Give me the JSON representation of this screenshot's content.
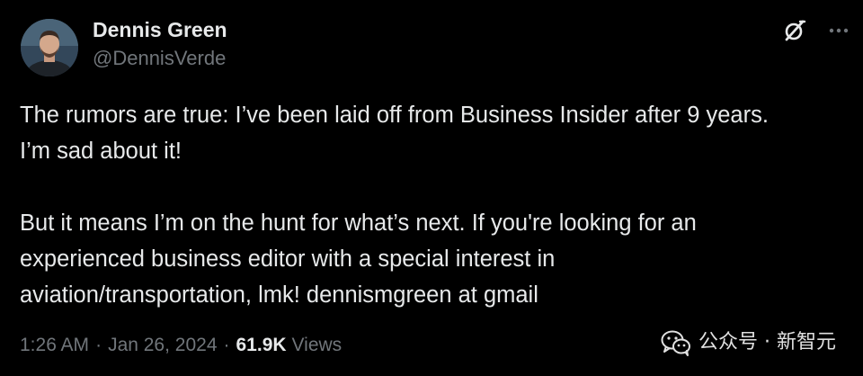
{
  "author": {
    "display_name": "Dennis Green",
    "handle": "@DennisVerde"
  },
  "tweet": {
    "text": "The rumors are true: I’ve been laid off from Business Insider after 9 years.\nI’m sad about it!\n\nBut it means I’m on the hunt for what’s next. If you're looking for an\nexperienced business editor with a special interest in\naviation/transportation, lmk! dennismgreen at gmail"
  },
  "meta": {
    "time": "1:26 AM",
    "separator": "·",
    "date": "Jan 26, 2024",
    "views_count": "61.9K",
    "views_label": "Views"
  },
  "icons": {
    "grok": "grok-icon",
    "more": "more-icon",
    "watermark": "wechat-icon"
  },
  "watermark": {
    "text": "公众号 · 新智元"
  },
  "colors": {
    "background": "#000000",
    "primary_text": "#e7e9ea",
    "secondary_text": "#71767b"
  }
}
